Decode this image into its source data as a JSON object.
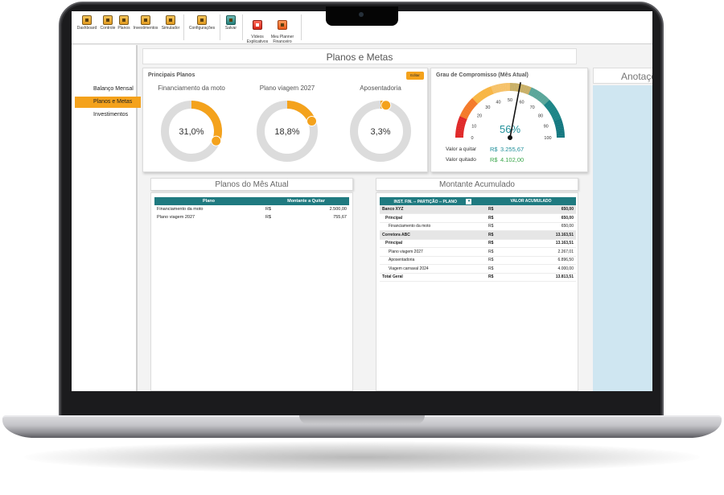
{
  "ribbon": {
    "buttons": [
      {
        "label": "Dashboard",
        "icon": "dashboard-icon"
      },
      {
        "label": "Controle",
        "icon": "controle-icon"
      },
      {
        "label": "Planos",
        "icon": "planos-icon"
      },
      {
        "label": "Investimentos",
        "icon": "investimentos-icon"
      },
      {
        "label": "Simulador",
        "icon": "simulador-icon"
      },
      {
        "label": "Configurações",
        "icon": "configuracoes-icon"
      },
      {
        "label": "Salvar",
        "icon": "save-icon"
      },
      {
        "label": "Vídeos\nExplicativos",
        "icon": "youtube-icon"
      },
      {
        "label": "Meu Planner\nFinanceiro",
        "icon": "planner-icon"
      }
    ]
  },
  "sidebar": {
    "items": [
      {
        "label": "Balanço Mensal",
        "active": false
      },
      {
        "label": "Planos e Metas",
        "active": true
      },
      {
        "label": "Investimentos",
        "active": false
      }
    ]
  },
  "page": {
    "title": "Planos e Metas"
  },
  "principais": {
    "heading": "Principais Planos",
    "edit_label": "Editar",
    "plans": [
      {
        "name": "Financiamento da moto",
        "percent": 31.0,
        "label": "31,0%"
      },
      {
        "name": "Plano viagem 2027",
        "percent": 18.8,
        "label": "18,8%"
      },
      {
        "name": "Aposentadoria",
        "percent": 3.3,
        "label": "3,3%"
      }
    ],
    "colors": {
      "fill": "#f4a21c",
      "track": "#dcdcdc"
    }
  },
  "gauge": {
    "heading": "Grau de Compromisso (Mês Atual)",
    "value_label": "56%",
    "value": 56,
    "ticks": [
      "0",
      "10",
      "20",
      "30",
      "40",
      "50",
      "60",
      "70",
      "80",
      "90",
      "100"
    ],
    "quitar_label": "Valor a quitar",
    "quitar_currency": "R$",
    "quitar_value": "3.255,67",
    "quitado_label": "Valor quitado",
    "quitado_currency": "R$",
    "quitado_value": "4.102,00"
  },
  "planos_mes": {
    "title": "Planos do Mês Atual",
    "columns": [
      "Plano",
      "Montante a Quitar"
    ],
    "rows": [
      {
        "plano": "Financiamento da moto",
        "currency": "R$",
        "valor": "2.500,00"
      },
      {
        "plano": "Plano viagem 2027",
        "currency": "R$",
        "valor": "755,67"
      }
    ]
  },
  "montante": {
    "title": "Montante Acumulado",
    "columns": [
      "INST. FIN. -- PARTIÇÃO -- PLANO",
      "VALOR ACUMULADO"
    ],
    "rows": [
      {
        "level": 0,
        "label": "Banco XYZ",
        "currency": "R$",
        "valor": "650,00"
      },
      {
        "level": 1,
        "label": "Principal",
        "currency": "R$",
        "valor": "650,00"
      },
      {
        "level": 2,
        "label": "Financiamento da moto",
        "currency": "R$",
        "valor": "650,00"
      },
      {
        "level": 0,
        "label": "Corretora ABC",
        "currency": "R$",
        "valor": "13.163,51"
      },
      {
        "level": 1,
        "label": "Principal",
        "currency": "R$",
        "valor": "13.163,51"
      },
      {
        "level": 2,
        "label": "Plano viagem 2027",
        "currency": "R$",
        "valor": "2.267,01"
      },
      {
        "level": 2,
        "label": "Aposentadoria",
        "currency": "R$",
        "valor": "6.896,50"
      },
      {
        "level": 2,
        "label": "Viagem carnaval 2024",
        "currency": "R$",
        "valor": "4.000,00"
      },
      {
        "level": 9,
        "label": "Total Geral",
        "currency": "R$",
        "valor": "13.813,51"
      }
    ]
  },
  "notes": {
    "title": "Anotações"
  }
}
